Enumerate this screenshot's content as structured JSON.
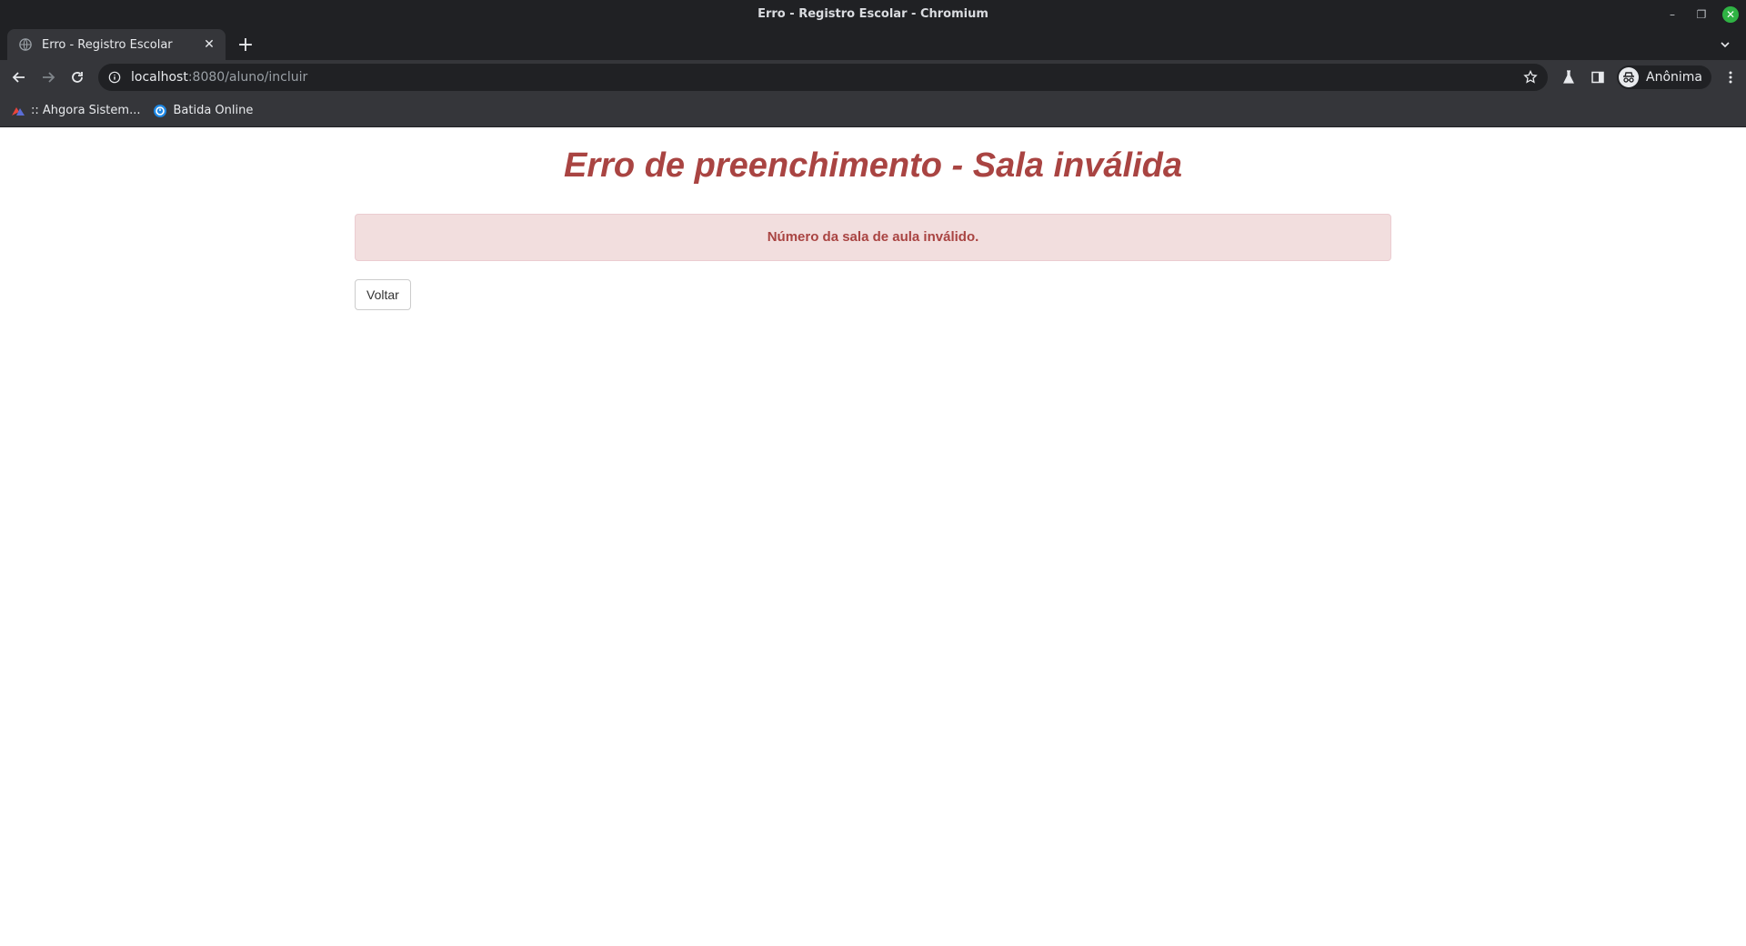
{
  "window": {
    "title": "Erro - Registro Escolar - Chromium"
  },
  "tabs": [
    {
      "label": "Erro - Registro Escolar"
    }
  ],
  "address_bar": {
    "host": "localhost",
    "path": ":8080/aluno/incluir"
  },
  "profile": {
    "name": "Anônima"
  },
  "bookmarks": [
    {
      "label": ":: Ahgora Sistem...",
      "icon": "ahgora-logo-icon"
    },
    {
      "label": "Batida Online",
      "icon": "batida-online-icon"
    }
  ],
  "page": {
    "title": "Erro de preenchimento - Sala inválida",
    "alert_message": "Número da sala de aula inválido.",
    "back_button": "Voltar"
  },
  "colors": {
    "error_text": "#a94442",
    "alert_background": "#f2dede",
    "alert_border": "#ebccd1",
    "browser_chrome": "#35363a",
    "titlebar": "#202124"
  }
}
